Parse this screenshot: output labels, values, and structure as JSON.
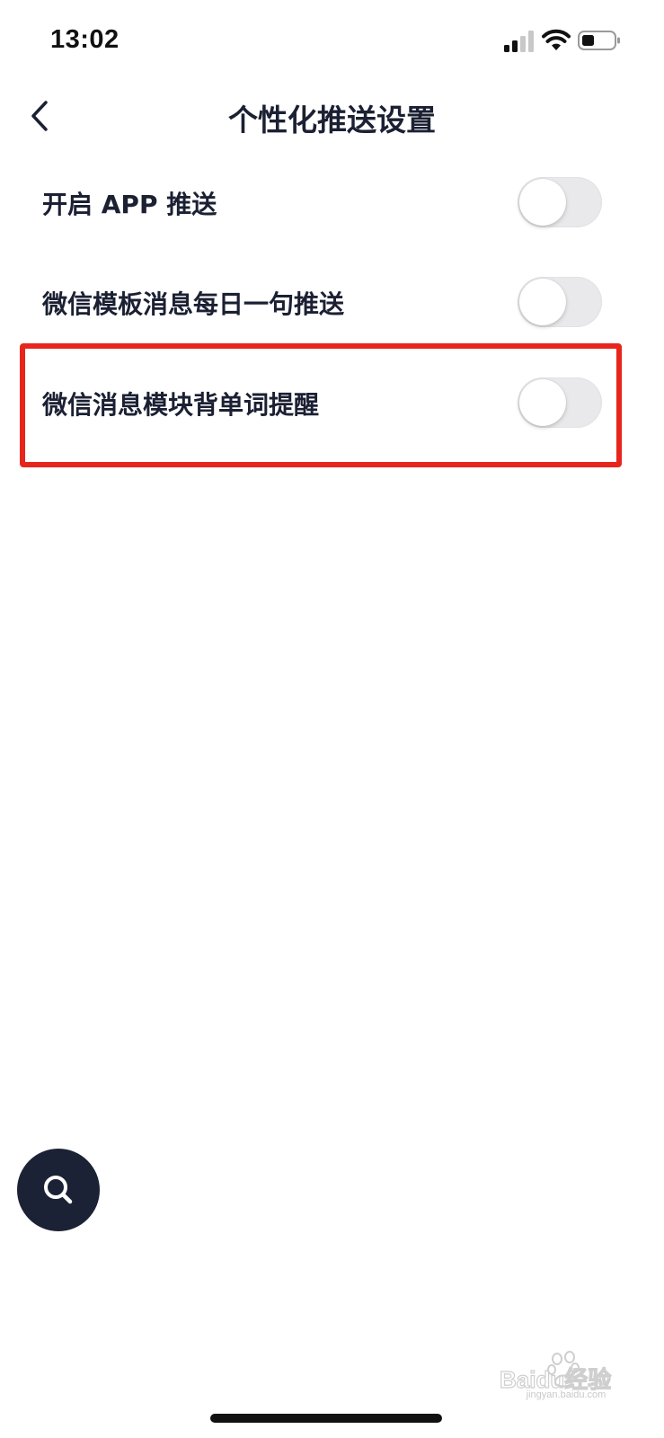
{
  "status_bar": {
    "time": "13:02",
    "icons": [
      "signal-icon",
      "wifi-icon",
      "battery-icon"
    ]
  },
  "nav": {
    "back_icon": "chevron-left-icon",
    "title": "个性化推送设置"
  },
  "settings": [
    {
      "label": "开启 APP 推送",
      "enabled": false
    },
    {
      "label": "微信模板消息每日一句推送",
      "enabled": false
    },
    {
      "label": "微信消息模块背单词提醒",
      "enabled": false,
      "highlighted": true
    }
  ],
  "search_fab": {
    "icon": "search-icon"
  },
  "watermark": {
    "logo_text": "Baidu经验",
    "url": "jingyan.baidu.com"
  },
  "colors": {
    "text": "#1b2033",
    "highlight": "#e8251d",
    "fab": "#1c2235",
    "toggle_off": "#e9e9ec"
  }
}
